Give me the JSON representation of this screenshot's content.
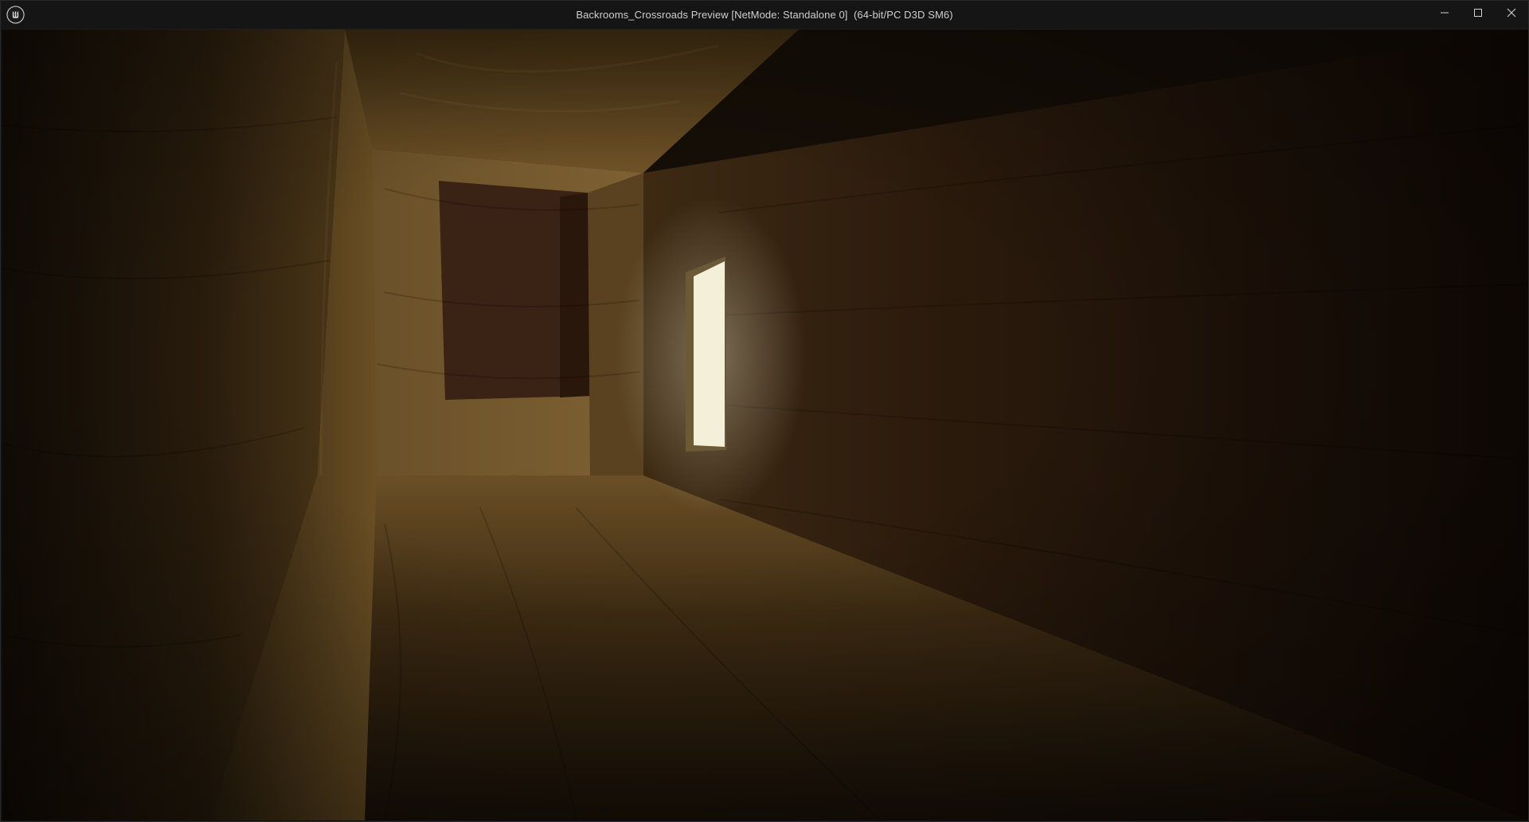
{
  "window": {
    "title": "Backrooms_Crossroads Preview [NetMode: Standalone 0]  (64-bit/PC D3D SM6)",
    "app_icon": "unreal-engine-logo-icon",
    "controls": {
      "minimize": "minimize-icon",
      "maximize": "maximize-icon",
      "close": "close-icon"
    }
  },
  "viewport": {
    "scene": "wooden corridor with a bright window on the right wall and a dark doorway at the end",
    "colors": {
      "wood_light": "#7a5a2e",
      "wood_mid": "#4a3418",
      "wood_dark": "#1e1409",
      "window_glow": "#f4efd8"
    }
  }
}
